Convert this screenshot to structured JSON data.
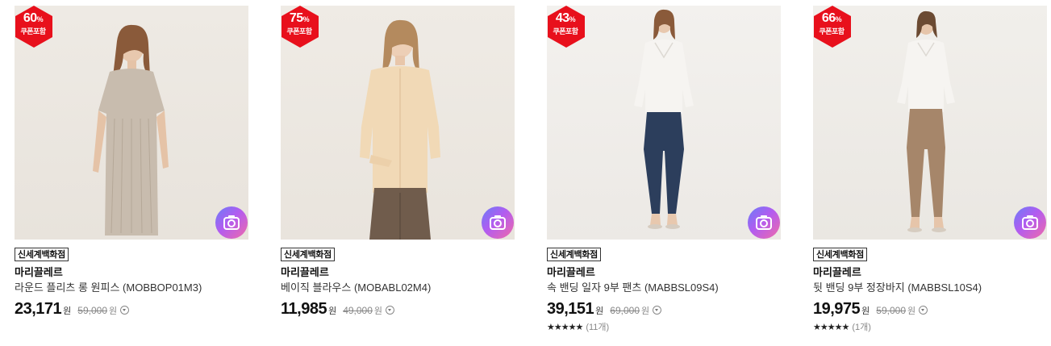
{
  "colors": {
    "badge": "#e8101c",
    "camera_gradient": [
      "#6a7cf7",
      "#b25cf0",
      "#f06aa9"
    ],
    "outfits": [
      {
        "top": "#c8bcae",
        "bottom": "#c8bcae",
        "hair": "#8a5a3a"
      },
      {
        "top": "#f1d9b6",
        "bottom": "#705c4c",
        "hair": "#b48a5e"
      },
      {
        "top": "#f6f4f1",
        "bottom": "#2c3e5c",
        "hair": "#8a5a3a"
      },
      {
        "top": "#f6f4f1",
        "bottom": "#a6866a",
        "hair": "#6b4a32"
      }
    ]
  },
  "products": [
    {
      "discount": "60",
      "discount_unit": "%",
      "coupon_label": "쿠폰포함",
      "store": "신세계백화점",
      "brand": "마리끌레르",
      "name": "라운드 플리츠 롱 원피스 (MOBBOP01M3)",
      "price": "23,171",
      "currency": "원",
      "original_price": "59,000",
      "original_currency": "원",
      "rating": null,
      "review_count": null
    },
    {
      "discount": "75",
      "discount_unit": "%",
      "coupon_label": "쿠폰포함",
      "store": "신세계백화점",
      "brand": "마리끌레르",
      "name": "베이직 블라우스 (MOBABL02M4)",
      "price": "11,985",
      "currency": "원",
      "original_price": "49,000",
      "original_currency": "원",
      "rating": null,
      "review_count": null
    },
    {
      "discount": "43",
      "discount_unit": "%",
      "coupon_label": "쿠폰포함",
      "store": "신세계백화점",
      "brand": "마리끌레르",
      "name": "속 밴딩 일자 9부 팬츠 (MABBSL09S4)",
      "price": "39,151",
      "currency": "원",
      "original_price": "69,000",
      "original_currency": "원",
      "rating": "★★★★★",
      "review_count": "(11개)"
    },
    {
      "discount": "66",
      "discount_unit": "%",
      "coupon_label": "쿠폰포함",
      "store": "신세계백화점",
      "brand": "마리끌레르",
      "name": "뒷 밴딩 9부 정장바지 (MABBSL10S4)",
      "price": "19,975",
      "currency": "원",
      "original_price": "59,000",
      "original_currency": "원",
      "rating": "★★★★★",
      "review_count": "(1개)"
    }
  ]
}
